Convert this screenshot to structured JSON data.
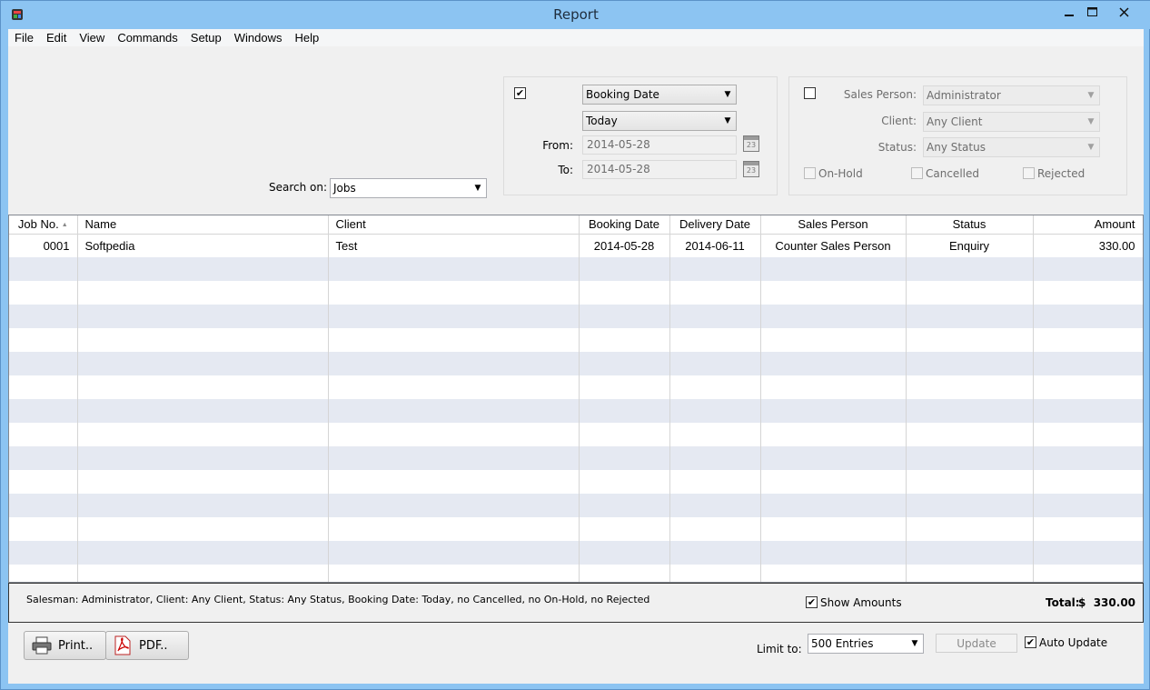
{
  "window": {
    "title": "Report"
  },
  "menu": [
    "File",
    "Edit",
    "View",
    "Commands",
    "Setup",
    "Windows",
    "Help"
  ],
  "search": {
    "label": "Search on:",
    "value": "Jobs"
  },
  "date_filter": {
    "field": "Booking Date",
    "range": "Today",
    "from_label": "From:",
    "from_value": "2014-05-28",
    "to_label": "To:",
    "to_value": "2014-05-28",
    "calendar_day": "23"
  },
  "people_filter": {
    "sales_person_label": "Sales Person:",
    "sales_person_value": "Administrator",
    "client_label": "Client:",
    "client_value": "Any Client",
    "status_label": "Status:",
    "status_value": "Any Status",
    "on_hold": "On-Hold",
    "cancelled": "Cancelled",
    "rejected": "Rejected"
  },
  "table": {
    "columns": [
      "Job No.",
      "Name",
      "Client",
      "Booking Date",
      "Delivery Date",
      "Sales Person",
      "Status",
      "Amount"
    ],
    "rows": [
      [
        "0001",
        "Softpedia",
        "Test",
        "2014-05-28",
        "2014-06-11",
        "Counter Sales Person",
        "Enquiry",
        "330.00"
      ]
    ]
  },
  "summary": {
    "description": "Salesman: Administrator, Client: Any Client, Status: Any Status, Booking Date: Today, no Cancelled, no On-Hold, no Rejected",
    "show_amounts": "Show Amounts",
    "total_label": "Total:",
    "total_value": "$  330.00"
  },
  "footer": {
    "print": "Print..",
    "pdf": "PDF..",
    "limit_label": "Limit to:",
    "limit_value": "500 Entries",
    "update": "Update",
    "auto_update": "Auto Update"
  }
}
